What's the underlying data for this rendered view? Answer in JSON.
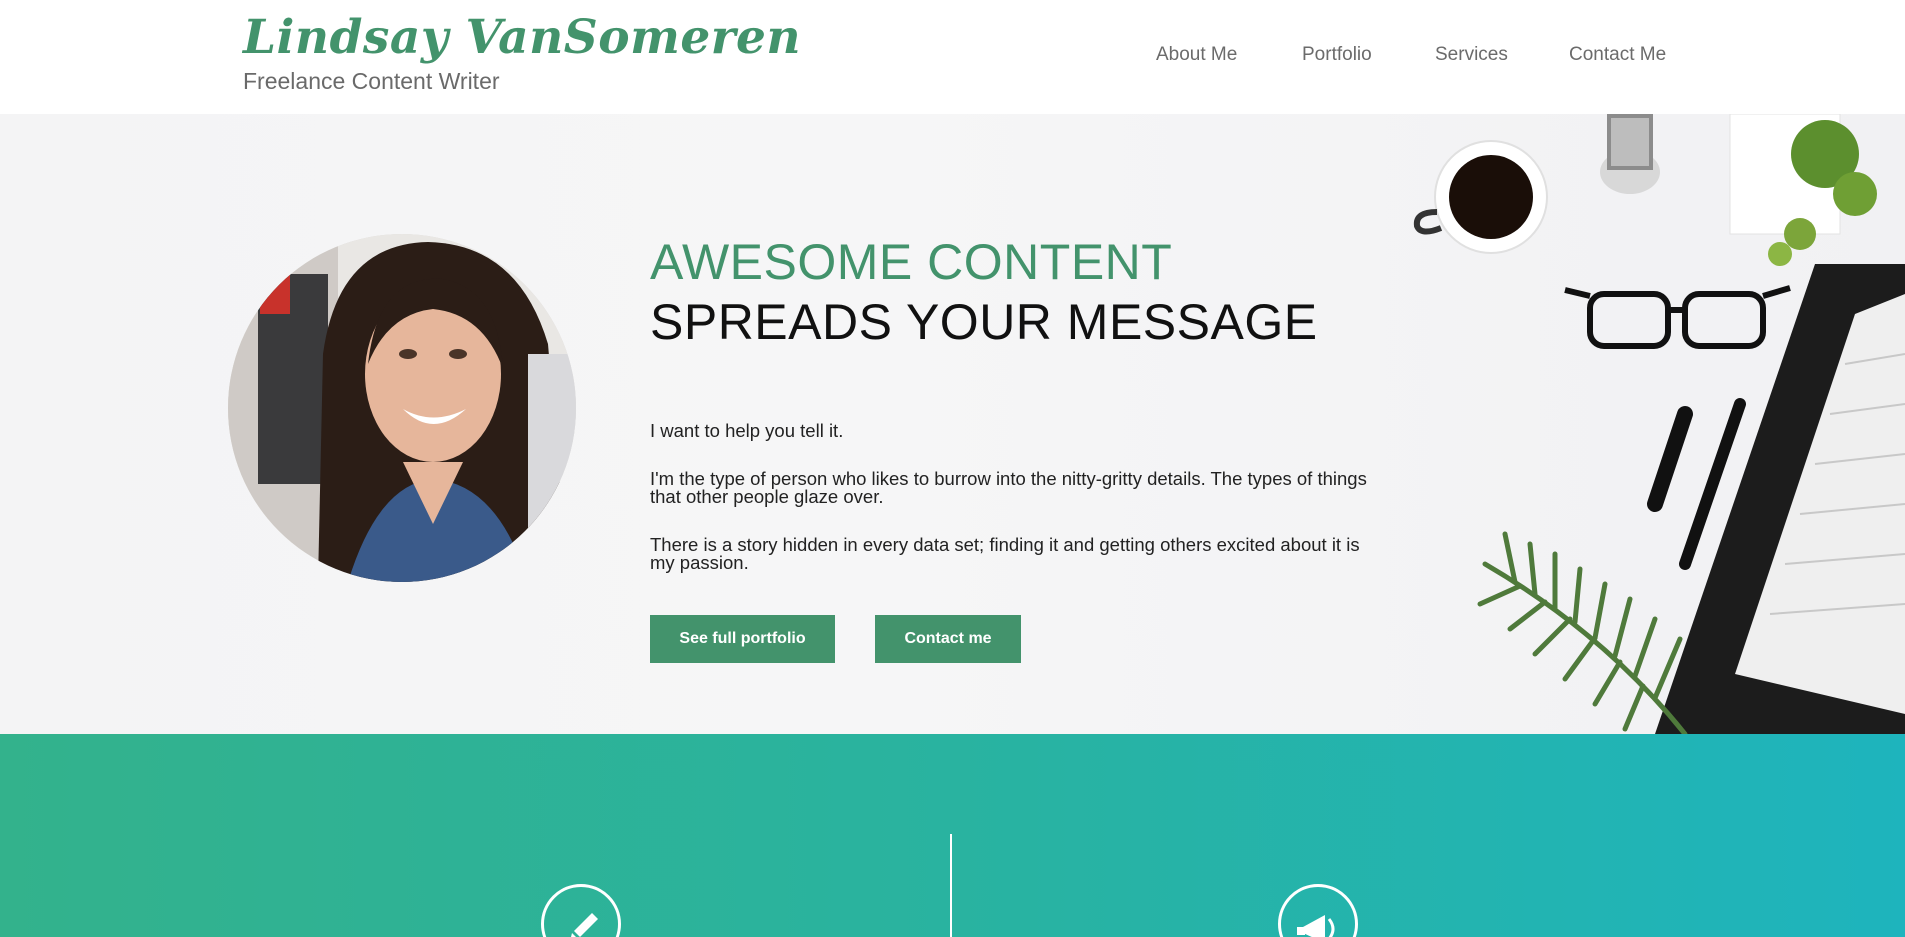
{
  "header": {
    "logo_name": "Lindsay VanSomeren",
    "logo_tagline": "Freelance Content Writer",
    "nav": [
      {
        "label": "About Me"
      },
      {
        "label": "Portfolio"
      },
      {
        "label": "Services"
      },
      {
        "label": "Contact Me"
      }
    ]
  },
  "hero": {
    "headline_accent": "AWESOME CONTENT",
    "headline_main": "SPREADS YOUR MESSAGE",
    "paragraphs": [
      "I want to help you tell it.",
      "I'm the type of person who likes to burrow into the nitty-gritty details. The types of things that other people glaze over.",
      "There is a story hidden in every data set; finding it and getting others excited about it is my passion."
    ],
    "buttons": {
      "portfolio": "See full portfolio",
      "contact": "Contact me"
    }
  },
  "services": {
    "icons": [
      "pencil-icon",
      "megaphone-icon"
    ]
  },
  "colors": {
    "brand_green": "#43936c",
    "band_start": "#33b28c",
    "band_end": "#1eb4bd",
    "nav_text": "#6b6b6b"
  }
}
